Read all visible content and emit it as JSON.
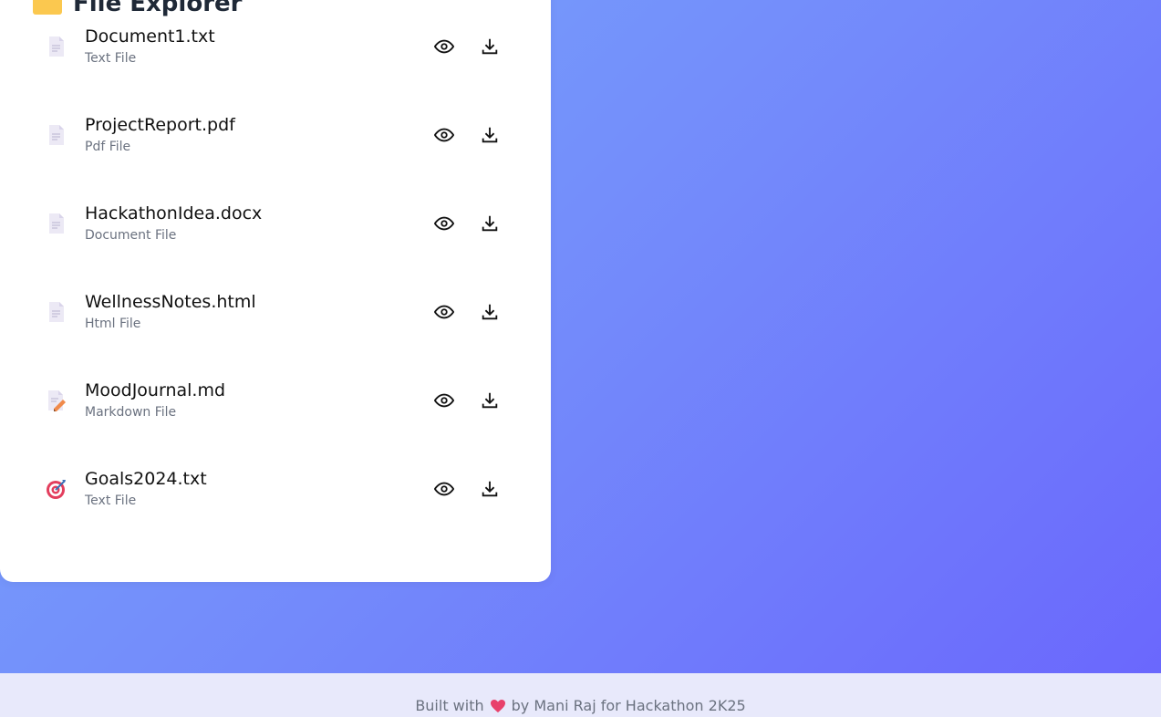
{
  "panel": {
    "title": "File Explorer",
    "title_icon": "folder-icon"
  },
  "files": [
    {
      "name": "Document1.txt",
      "type": "Text File",
      "icon": "document-icon"
    },
    {
      "name": "ProjectReport.pdf",
      "type": "Pdf File",
      "icon": "document-icon"
    },
    {
      "name": "HackathonIdea.docx",
      "type": "Document File",
      "icon": "document-icon"
    },
    {
      "name": "WellnessNotes.html",
      "type": "Html File",
      "icon": "document-icon"
    },
    {
      "name": "MoodJournal.md",
      "type": "Markdown File",
      "icon": "memo-icon"
    },
    {
      "name": "Goals2024.txt",
      "type": "Text File",
      "icon": "target-icon"
    }
  ],
  "actions": {
    "view_icon": "eye-icon",
    "download_icon": "download-icon"
  },
  "footer": {
    "prefix": "Built with",
    "heart_icon": "heart-icon",
    "suffix": "by Mani Raj for Hackathon 2K25"
  },
  "colors": {
    "gradient_start": "#78a9fb",
    "gradient_end": "#6a66fd",
    "footer_bg": "#e8e9fb",
    "heart": "#e8416b"
  }
}
